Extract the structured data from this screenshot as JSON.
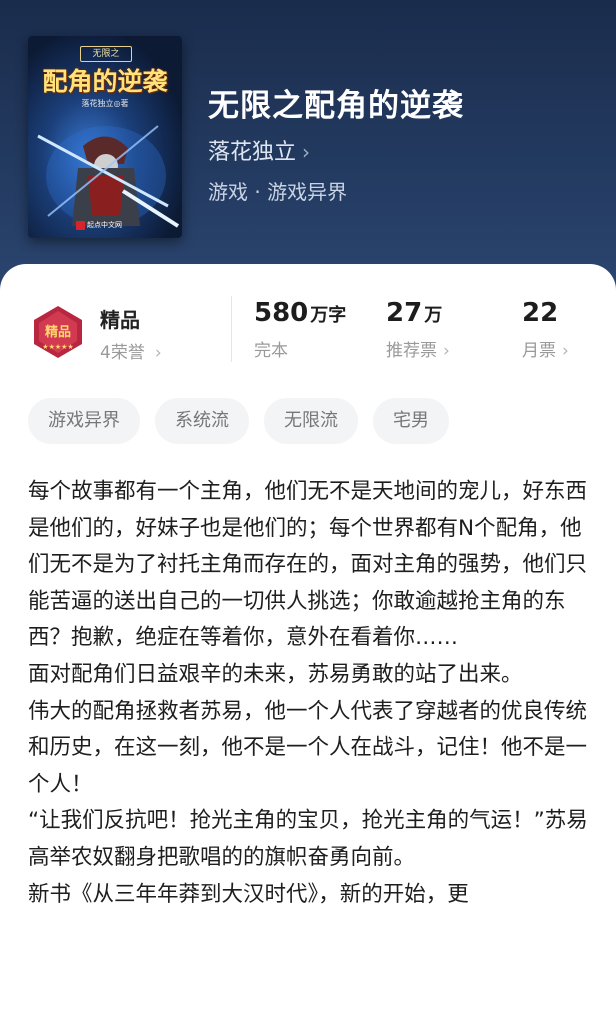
{
  "book": {
    "cover": {
      "series_label": "无限之",
      "title": "配角的逆袭",
      "author_line": "落花独立◎著",
      "publisher": "起点中文网"
    },
    "title": "无限之配角的逆袭",
    "author": "落花独立",
    "category": "游戏 · 游戏异界"
  },
  "honor": {
    "badge_text": "精品",
    "label": "精品",
    "count": "4荣誉"
  },
  "stats": [
    {
      "value": "580",
      "unit": "万字",
      "label": "完本"
    },
    {
      "value": "27",
      "unit": "万",
      "label": "推荐票"
    },
    {
      "value": "22",
      "unit": "",
      "label": "月票"
    }
  ],
  "tags": [
    "游戏异界",
    "系统流",
    "无限流",
    "宅男"
  ],
  "intro": [
    "每个故事都有一个主角，他们无不是天地间的宠儿，好东西是他们的，好妹子也是他们的；每个世界都有N个配角，他们无不是为了衬托主角而存在的，面对主角的强势，他们只能苦逼的送出自己的一切供人挑选；你敢逾越抢主角的东西？抱歉，绝症在等着你，意外在看着你……",
    "面对配角们日益艰辛的未来，苏易勇敢的站了出来。",
    "伟大的配角拯救者苏易，他一个人代表了穿越者的优良传统和历史，在这一刻，他不是一个人在战斗，记住！他不是一个人！",
    "“让我们反抗吧！抢光主角的宝贝，抢光主角的气运！”苏易高举农奴翻身把歌唱的的旗帜奋勇向前。",
    "新书《从三年年莽到大汉时代》，新的开始，更"
  ],
  "colors": {
    "header_bg": "#233a60",
    "badge": "#b8263f",
    "text_primary": "#1e1e1e",
    "text_secondary": "#9a9a9a"
  }
}
